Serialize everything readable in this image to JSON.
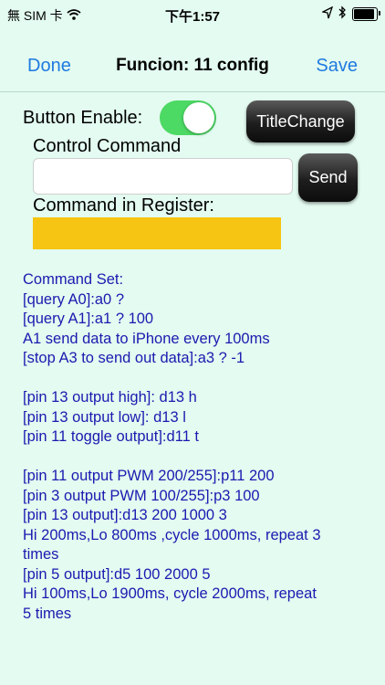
{
  "status_bar": {
    "carrier": "無 SIM 卡",
    "time": "下午1:57",
    "battery_level": 0.9,
    "icons": [
      "wifi-icon",
      "location-icon",
      "bluetooth-icon",
      "battery-icon"
    ]
  },
  "nav": {
    "done": "Done",
    "title": "Funcion: 11 config",
    "save": "Save"
  },
  "form": {
    "button_enable_label": "Button Enable:",
    "toggle_on": true,
    "title_change": "TitleChange",
    "control_command_label": "Control Command",
    "command_value": "",
    "send": "Send",
    "command_in_register_label": "Command in Register:",
    "register_value": ""
  },
  "command_set": {
    "lines": [
      "Command Set:",
      "[query A0]:a0 ?",
      "[query A1]:a1 ? 100",
      "A1 send data to iPhone every 100ms",
      "[stop A3 to send out data]:a3 ? -1",
      "",
      "[pin 13 output high]: d13 h",
      "[pin 13 output low]: d13 l",
      "[pin 11 toggle output]:d11 t",
      "",
      "[pin 11 output PWM 200/255]:p11 200",
      "[pin 3 output PWM 100/255]:p3 100",
      "[pin 13 output]:d13 200 1000 3",
      "Hi 200ms,Lo 800ms ,cycle 1000ms, repeat 3",
      "times",
      "[pin 5 output]:d5 100 2000 5",
      "Hi 100ms,Lo 1900ms, cycle 2000ms, repeat",
      "5 times"
    ]
  },
  "colors": {
    "background": "#e3fbf0",
    "accent": "#1f7ae0",
    "toggle_on": "#4cd964",
    "register": "#f6c412",
    "command_text": "#1a1ab0"
  }
}
